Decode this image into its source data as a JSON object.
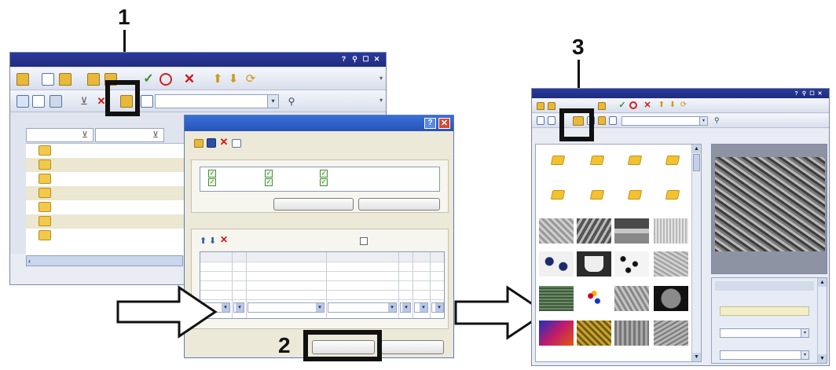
{
  "steps": {
    "one": "1",
    "two": "2",
    "three": "3"
  },
  "left_window": {
    "titlebar_buttons": [
      "?",
      "⚲",
      "☐",
      "✕"
    ],
    "overflow_glyph": "▾"
  },
  "dialog": {
    "help_button": "?",
    "close_button": "✕",
    "checkbox_glyph": "✓",
    "up_arrow": "⬆",
    "down_arrow": "⬇",
    "delete_glyph": "✕"
  },
  "right_window": {
    "titlebar_buttons": [
      "?",
      "⚲",
      "☐",
      "✕"
    ]
  },
  "colors": {
    "titlebar": "#1e2c7e",
    "dialog_titlebar": "#2654b8",
    "callout": "#111111",
    "folder": "#f1c94b"
  }
}
